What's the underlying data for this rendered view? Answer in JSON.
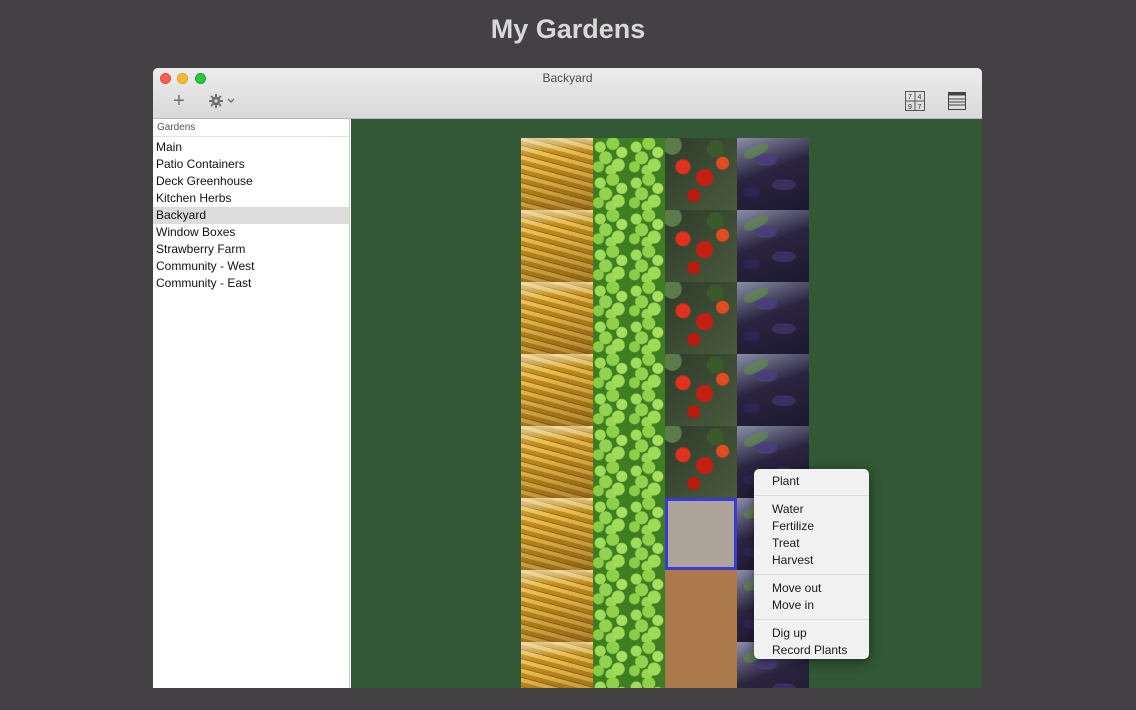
{
  "page": {
    "title": "My Gardens"
  },
  "window": {
    "title": "Backyard",
    "toolbar": {
      "add_icon": "plus-icon",
      "settings_icon": "gear-icon",
      "grid_view_icon": "grid-view-icon",
      "grid_view_digits": [
        "7",
        "4",
        "9",
        "7"
      ],
      "list_view_icon": "list-view-icon"
    }
  },
  "sidebar": {
    "header": "Gardens",
    "selected": "Backyard",
    "items": [
      "Main",
      "Patio Containers",
      "Deck Greenhouse",
      "Kitchen Herbs",
      "Backyard",
      "Window Boxes",
      "Strawberry Farm",
      "Community - West",
      "Community - East"
    ]
  },
  "garden_grid": {
    "columns": 4,
    "rows": [
      [
        "corn",
        "peas",
        "tomato",
        "eggplant"
      ],
      [
        "corn",
        "peas",
        "tomato",
        "eggplant"
      ],
      [
        "corn",
        "peas",
        "tomato",
        "eggplant"
      ],
      [
        "corn",
        "peas",
        "tomato",
        "eggplant"
      ],
      [
        "corn",
        "peas",
        "tomato",
        "eggplant"
      ],
      [
        "corn",
        "peas",
        "selected",
        "eggplant"
      ],
      [
        "corn",
        "peas",
        "empty",
        "eggplant"
      ],
      [
        "corn",
        "peas",
        "empty",
        "eggplant"
      ]
    ]
  },
  "context_menu": {
    "groups": [
      [
        "Plant"
      ],
      [
        "Water",
        "Fertilize",
        "Treat",
        "Harvest"
      ],
      [
        "Move out",
        "Move in"
      ],
      [
        "Dig up",
        "Record Plants"
      ]
    ]
  },
  "colors": {
    "background": "#434144",
    "garden_background": "#325836",
    "selection_border": "#3a3ad6",
    "soil": "#ac7a4a"
  }
}
